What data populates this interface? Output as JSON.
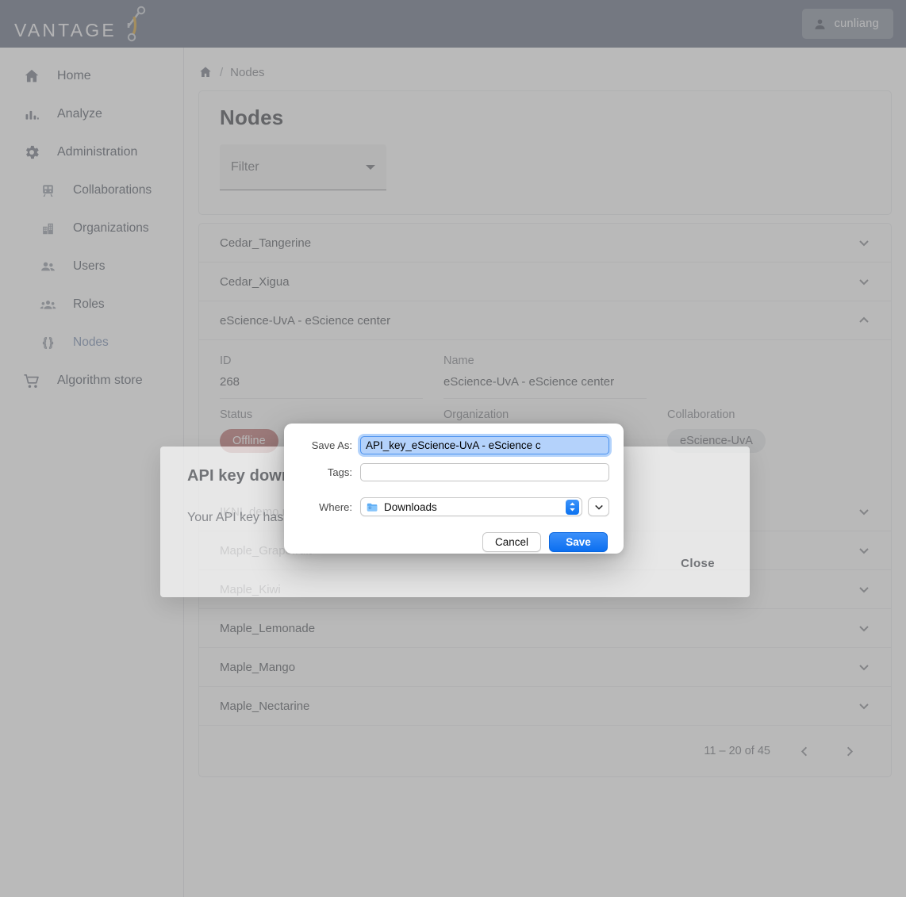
{
  "header": {
    "brand": "VANTAGE",
    "brand_mark_icon": "vantage-logo-icon",
    "user_icon": "person-icon",
    "user_name": "cunliang"
  },
  "sidebar": {
    "items": [
      {
        "label": "Home",
        "icon": "home-icon",
        "sub": false,
        "active": false
      },
      {
        "label": "Analyze",
        "icon": "bar-chart-icon",
        "sub": false,
        "active": false
      },
      {
        "label": "Administration",
        "icon": "gear-icon",
        "sub": false,
        "active": false
      },
      {
        "label": "Collaborations",
        "icon": "train-icon",
        "sub": true,
        "active": false
      },
      {
        "label": "Organizations",
        "icon": "building-icon",
        "sub": true,
        "active": false
      },
      {
        "label": "Users",
        "icon": "people-icon",
        "sub": true,
        "active": false
      },
      {
        "label": "Roles",
        "icon": "group-icon",
        "sub": true,
        "active": false
      },
      {
        "label": "Nodes",
        "icon": "braces-icon",
        "sub": true,
        "active": true
      },
      {
        "label": "Algorithm store",
        "icon": "shopping-cart-icon",
        "sub": false,
        "active": false
      }
    ]
  },
  "breadcrumb": {
    "home_icon": "home-icon",
    "separator": "/",
    "current": "Nodes"
  },
  "page": {
    "title": "Nodes",
    "filter": {
      "placeholder": "Filter",
      "value": "",
      "caret_icon": "caret-down-icon"
    }
  },
  "nodes": {
    "rows": [
      {
        "name": "Cedar_Tangerine",
        "expanded": false,
        "chevron_icon": "chevron-down-icon"
      },
      {
        "name": "Cedar_Xigua",
        "expanded": false,
        "chevron_icon": "chevron-down-icon"
      },
      {
        "name": "eScience-UvA - eScience center",
        "expanded": true,
        "chevron_icon": "chevron-up-icon"
      },
      {
        "name": "IKNL demo node",
        "expanded": false,
        "chevron_icon": "chevron-down-icon"
      },
      {
        "name": "Maple_Grapefruit",
        "expanded": false,
        "chevron_icon": "chevron-down-icon"
      },
      {
        "name": "Maple_Kiwi",
        "expanded": false,
        "chevron_icon": "chevron-down-icon"
      },
      {
        "name": "Maple_Lemonade",
        "expanded": false,
        "chevron_icon": "chevron-down-icon"
      },
      {
        "name": "Maple_Mango",
        "expanded": false,
        "chevron_icon": "chevron-down-icon"
      },
      {
        "name": "Maple_Nectarine",
        "expanded": false,
        "chevron_icon": "chevron-down-icon"
      }
    ],
    "detail": {
      "id_label": "ID",
      "id_value": "268",
      "name_label": "Name",
      "name_value": "eScience-UvA - eScience center",
      "status_label": "Status",
      "status_value": "Offline",
      "status_color": "#c07a7a",
      "organization_label": "Organization",
      "organization_value": "",
      "collaboration_label": "Collaboration",
      "collaboration_value": "eScience-UvA"
    }
  },
  "pagination": {
    "range_text": "11 – 20 of 45",
    "prev_icon": "chevron-left-icon",
    "next_icon": "chevron-right-icon"
  },
  "api_key_modal": {
    "title": "API key downloaded",
    "message": "Your API key has been downloaded.",
    "close_label": "Close"
  },
  "save_sheet": {
    "save_as_label": "Save As:",
    "save_as_value": "API_key_eScience-UvA - eScience c",
    "tags_label": "Tags:",
    "tags_value": "",
    "where_label": "Where:",
    "where_value": "Downloads",
    "folder_icon": "folder-icon",
    "stepper_icon": "up-down-stepper-icon",
    "expand_icon": "chevron-down-icon",
    "cancel_label": "Cancel",
    "save_label": "Save"
  },
  "colors": {
    "topbar": "#6d7688",
    "accent_blue": "#0c6ff0",
    "nav_active": "#7f93b5",
    "status_offline": "#c07a7a"
  }
}
